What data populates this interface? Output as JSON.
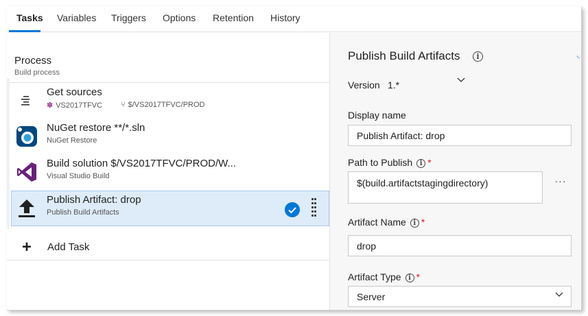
{
  "tabs": [
    {
      "label": "Tasks",
      "active": true
    },
    {
      "label": "Variables"
    },
    {
      "label": "Triggers"
    },
    {
      "label": "Options"
    },
    {
      "label": "Retention"
    },
    {
      "label": "History"
    }
  ],
  "process": {
    "title": "Process",
    "subtitle": "Build process"
  },
  "tasks": [
    {
      "title": "Get sources",
      "repo": "VS2017TFVC",
      "path": "$/VS2017TFVC/PROD",
      "icon": "get-sources-icon"
    },
    {
      "title": "NuGet restore **/*.sln",
      "subtitle": "NuGet Restore",
      "icon": "nuget-icon"
    },
    {
      "title": "Build solution $/VS2017TFVC/PROD/W...",
      "subtitle": "Visual Studio Build",
      "icon": "visual-studio-icon"
    },
    {
      "title": "Publish Artifact: drop",
      "subtitle": "Publish Build Artifacts",
      "icon": "upload-icon",
      "selected": true
    }
  ],
  "add_task": {
    "label": "Add Task"
  },
  "details": {
    "title": "Publish Build Artifacts",
    "version_label": "Version",
    "version_value": "1.*",
    "display_name": {
      "label": "Display name",
      "value": "Publish Artifact: drop"
    },
    "path_to_publish": {
      "label": "Path to Publish",
      "value": "$(build.artifactstagingdirectory)",
      "required_mark": "*",
      "browse_label": "···"
    },
    "artifact_name": {
      "label": "Artifact Name",
      "value": "drop",
      "required_mark": "*"
    },
    "artifact_type": {
      "label": "Artifact Type",
      "value": "Server",
      "required_mark": "*"
    }
  },
  "colors": {
    "accent": "#0078d7",
    "selected_bg": "#deecf9",
    "required": "#e81123",
    "vs_purple": "#68217a",
    "nuget_blue": "#004880"
  }
}
